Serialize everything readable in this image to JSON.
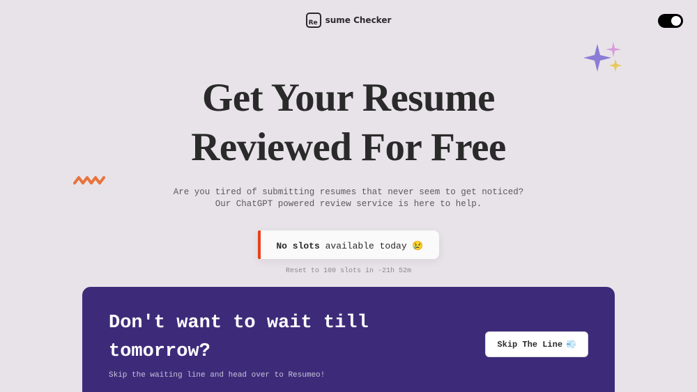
{
  "logo": {
    "text": "sume Checker"
  },
  "hero": {
    "title_line1": "Get Your Resume",
    "title_line2": "Reviewed For Free",
    "subtitle_line1": "Are you tired of submitting resumes that never seem to get noticed?",
    "subtitle_line2": "Our ChatGPT powered review service is here to help."
  },
  "status": {
    "bold": "No slots",
    "rest": " available today ",
    "emoji": "😢",
    "reset": "Reset to 100 slots in -21h 52m"
  },
  "bottom": {
    "title": "Don't want to wait till tomorrow?",
    "subtitle": "Skip the waiting line and head over to Resumeo!",
    "button": "Skip The Line",
    "button_emoji": "💨"
  }
}
